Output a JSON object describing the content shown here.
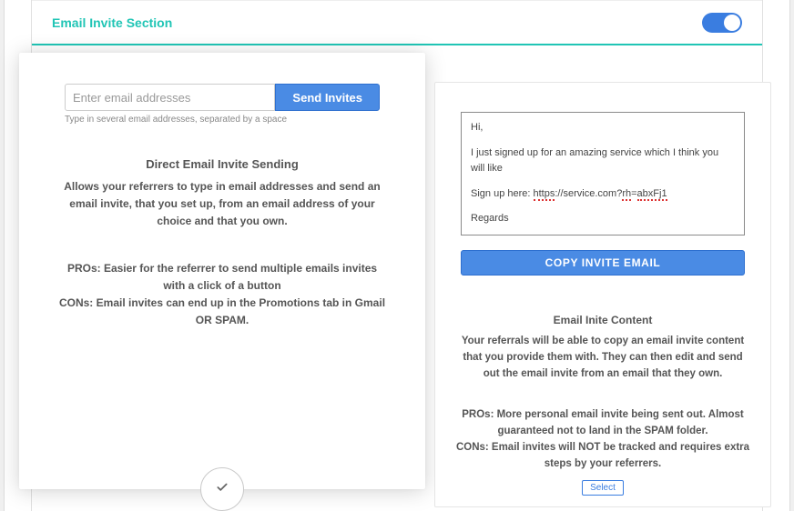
{
  "section": {
    "title": "Email Invite Section",
    "toggle_on": true
  },
  "left": {
    "email_placeholder": "Enter email addresses",
    "send_label": "Send Invites",
    "helper": "Type in several email addresses, separated by a space",
    "heading": "Direct Email Invite Sending",
    "body": "Allows your referrers to type in email addresses and send an email invite, that you set up, from an email address of your choice and that you own.",
    "pros": "PROs: Easier for the referrer to send multiple emails invites with a click of a button",
    "cons": "CONs: Email invites can end up in the Promotions tab in Gmail OR SPAM."
  },
  "right": {
    "msg_hi": "Hi,",
    "msg_body": "I just signed up for an amazing service which I think you will like",
    "msg_signup_label": "Sign up here: ",
    "msg_link_part1": "https",
    "msg_link_mid": "://service.com?",
    "msg_link_part2": "rh",
    "msg_link_part3": "=",
    "msg_link_part4": "abxFj1",
    "msg_regards": "Regards",
    "copy_label": "COPY INVITE EMAIL",
    "heading": "Email Inite Content",
    "body": "Your referrals will be able to copy an email invite content that you provide them with. They can then edit and send out the email invite from an email that they own.",
    "pros": "PROs: More personal email invite being sent out. Almost guaranteed not to land in the SPAM folder.",
    "cons": "CONs: Email invites will NOT be tracked and requires extra steps by your referrers.",
    "select_label": "Select"
  }
}
